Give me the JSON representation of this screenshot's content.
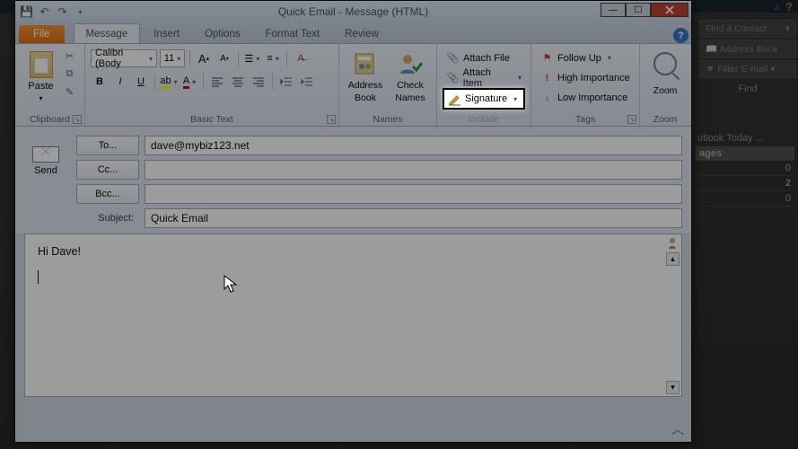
{
  "backdrop": {
    "find_contact": "Find a Contact",
    "address_book": "Address Book",
    "filter_email": "Filter E-mail",
    "find_label": "Find",
    "today_header": "utlook Today ...",
    "today_col": "ages",
    "counts": [
      "0",
      "2",
      "0"
    ]
  },
  "window": {
    "title": "Quick Email  -  Message (HTML)",
    "tabs": {
      "file": "File",
      "message": "Message",
      "insert": "Insert",
      "options": "Options",
      "format_text": "Format Text",
      "review": "Review"
    },
    "clipboard": {
      "paste": "Paste",
      "group": "Clipboard"
    },
    "basictext": {
      "font": "Calibri (Body",
      "size": "11",
      "group": "Basic Text"
    },
    "names": {
      "address_book_l1": "Address",
      "address_book_l2": "Book",
      "check_l1": "Check",
      "check_l2": "Names",
      "group": "Names"
    },
    "include": {
      "attach_file": "Attach File",
      "attach_item": "Attach Item",
      "signature": "Signature",
      "group": "Include"
    },
    "tags": {
      "follow_up": "Follow Up",
      "high": "High Importance",
      "low": "Low Importance",
      "group": "Tags"
    },
    "zoom": {
      "label": "Zoom",
      "group": "Zoom"
    },
    "addr": {
      "send": "Send",
      "to": "To...",
      "cc": "Cc...",
      "bcc": "Bcc...",
      "subject_label": "Subject:",
      "to_val": "dave@mybiz123.net",
      "cc_val": "",
      "bcc_val": "",
      "subject_val": "Quick Email"
    },
    "body": {
      "line1": "Hi Dave!"
    }
  }
}
